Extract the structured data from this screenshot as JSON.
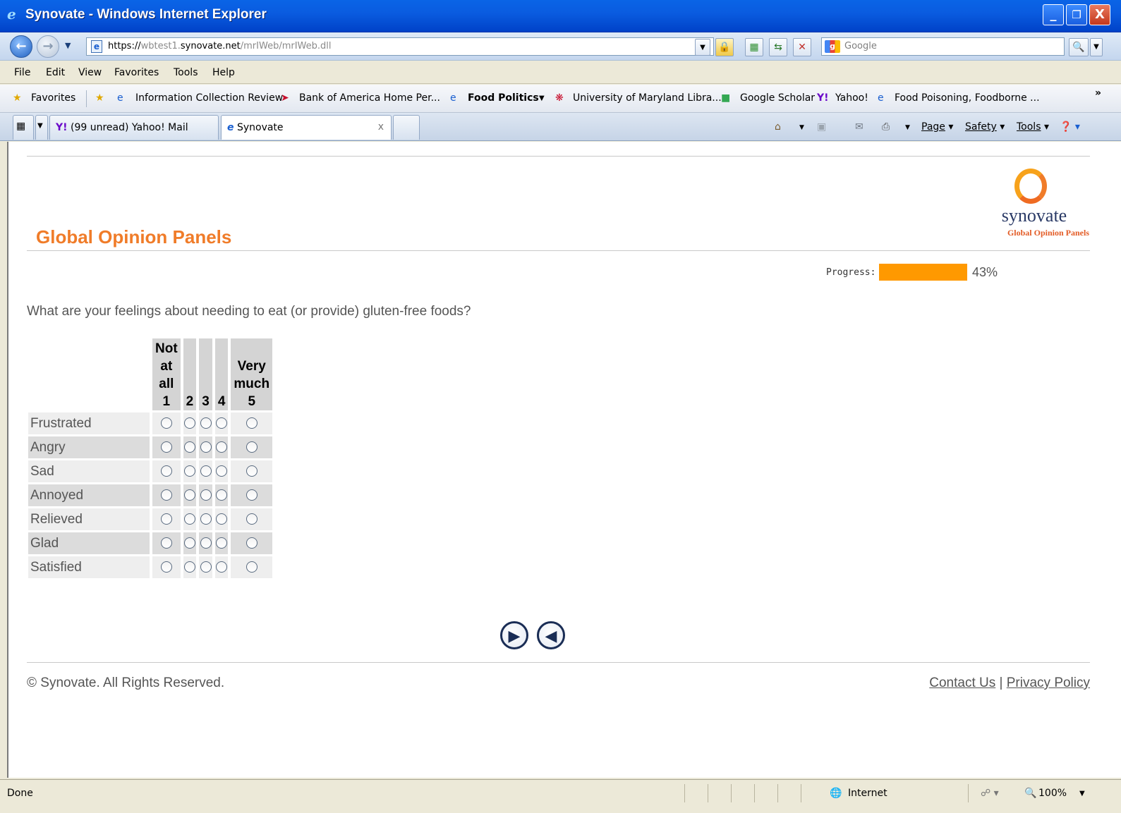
{
  "window": {
    "title": "Synovate - Windows Internet Explorer",
    "controls": {
      "minimize": "_",
      "maximize": "❐",
      "close": "X"
    }
  },
  "address": {
    "scheme": "https://",
    "sub": "wbtest1.",
    "domain": "synovate.net",
    "path": "/mrIWeb/mrIWeb.dll",
    "search_placeholder": "Google"
  },
  "menu": [
    "File",
    "Edit",
    "View",
    "Favorites",
    "Tools",
    "Help"
  ],
  "favorites": {
    "label": "Favorites",
    "items": [
      "Information Collection Review",
      "Bank of America  Home  Per...",
      "Food Politics",
      "University of Maryland Libra...",
      "Google Scholar",
      "Yahoo!",
      "Food Poisoning, Foodborne ..."
    ],
    "overflow": "»"
  },
  "tabs": [
    {
      "label": "(99 unread) Yahoo! Mail"
    },
    {
      "label": "Synovate",
      "close": "x"
    }
  ],
  "tab_tools": {
    "page": "Page",
    "safety": "Safety",
    "tools": "Tools"
  },
  "page": {
    "brand_title": "Global Opinion Panels",
    "logo_name": "synovate",
    "logo_sub": "Global Opinion Panels",
    "progress_label": "Progress:",
    "progress_value": 43,
    "progress_text": "43%",
    "question": "What are your feelings about needing to eat (or provide) gluten-free foods?",
    "columns": [
      {
        "lines": [
          "Not",
          "at",
          "all",
          "1"
        ]
      },
      {
        "lines": [
          "2"
        ]
      },
      {
        "lines": [
          "3"
        ]
      },
      {
        "lines": [
          "4"
        ]
      },
      {
        "lines": [
          "Very",
          "much",
          "5"
        ]
      }
    ],
    "rows": [
      "Frustrated",
      "Angry",
      "Sad",
      "Annoyed",
      "Relieved",
      "Glad",
      "Satisfied"
    ],
    "footer_copy": "© Synovate. All Rights Reserved.",
    "contact": "Contact Us",
    "separator": "|",
    "privacy": "Privacy Policy"
  },
  "status": {
    "text": "Done",
    "zone": "Internet",
    "zoom": "100%"
  }
}
